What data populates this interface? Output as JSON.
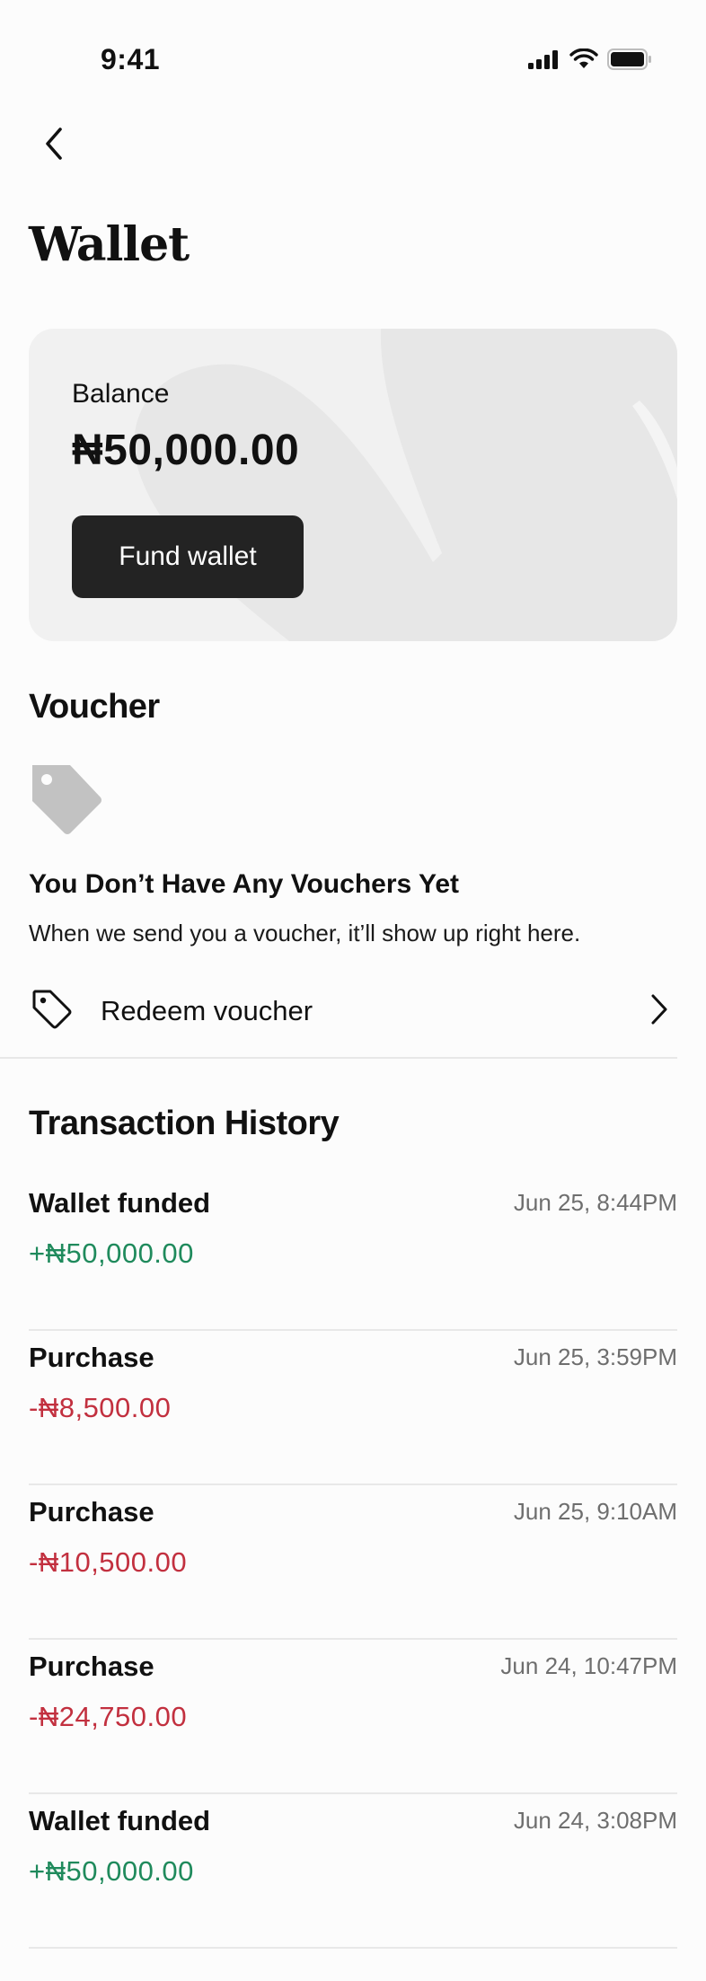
{
  "status_bar": {
    "time": "9:41"
  },
  "header": {
    "title": "Wallet"
  },
  "balance_card": {
    "label": "Balance",
    "amount": "₦50,000.00",
    "fund_button_label": "Fund wallet"
  },
  "voucher": {
    "section_title": "Voucher",
    "empty_title": "You Don’t Have Any Vouchers Yet",
    "empty_subtitle": "When we send you a voucher, it’ll show up right here.",
    "redeem_label": "Redeem voucher"
  },
  "history": {
    "section_title": "Transaction History",
    "transactions": [
      {
        "title": "Wallet funded",
        "amount": "+₦50,000.00",
        "date": "Jun 25, 8:44PM",
        "kind": "credit"
      },
      {
        "title": "Purchase",
        "amount": "-₦8,500.00",
        "date": "Jun 25, 3:59PM",
        "kind": "debit"
      },
      {
        "title": "Purchase",
        "amount": "-₦10,500.00",
        "date": "Jun 25, 9:10AM",
        "kind": "debit"
      },
      {
        "title": "Purchase",
        "amount": "-₦24,750.00",
        "date": "Jun 24, 10:47PM",
        "kind": "debit"
      },
      {
        "title": "Wallet funded",
        "amount": "+₦50,000.00",
        "date": "Jun 24, 3:08PM",
        "kind": "credit"
      }
    ]
  },
  "icons": {
    "signal": "signal-icon",
    "wifi": "wifi-icon",
    "battery": "battery-icon",
    "back": "chevron-left-icon",
    "voucher_tag": "tag-icon",
    "redeem": "tag-outline-icon",
    "redeem_chevron": "chevron-right-icon"
  },
  "colors": {
    "credit": "#1f8a5c",
    "debit": "#c2303f",
    "button_bg": "#232323",
    "card_bg": "#f1f1f1"
  }
}
